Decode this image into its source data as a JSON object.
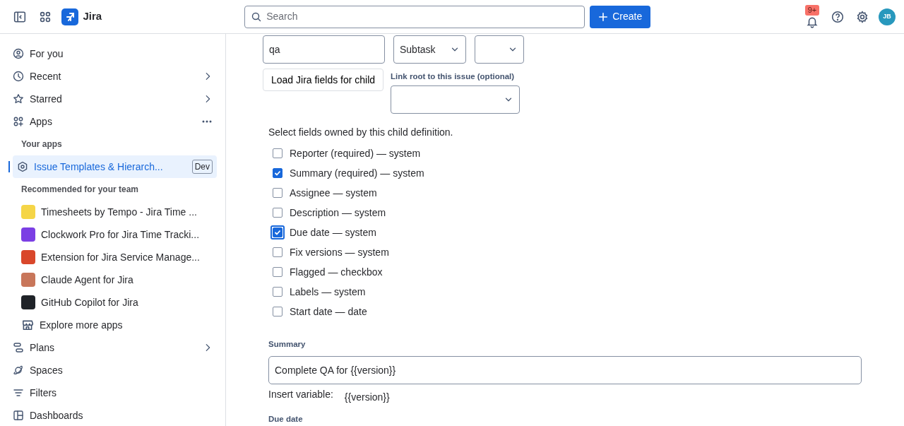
{
  "topbar": {
    "product": "Jira",
    "search": {
      "placeholder": "Search"
    },
    "create_button": "Create",
    "notifications_badge": "9+",
    "avatar": "JB"
  },
  "sidebar": {
    "items": [
      {
        "label": "For you",
        "chevron": false,
        "more": false
      },
      {
        "label": "Recent",
        "chevron": true,
        "more": false
      },
      {
        "label": "Starred",
        "chevron": true,
        "more": false
      },
      {
        "label": "Apps",
        "chevron": false,
        "more": true
      }
    ],
    "your_apps_heading": "Your apps",
    "your_apps": [
      {
        "label": "Issue Templates & Hierarch...",
        "tag": "Dev",
        "selected": true
      }
    ],
    "recommended_heading": "Recommended for your team",
    "recommended": [
      {
        "label": "Timesheets by Tempo - Jira Time ...",
        "color": "#f5d547"
      },
      {
        "label": "Clockwork Pro for Jira Time Tracki...",
        "color": "#7b3fe4"
      },
      {
        "label": "Extension for Jira Service Manage...",
        "color": "#d9472b"
      },
      {
        "label": "Claude Agent for Jira",
        "color": "#c8765a"
      },
      {
        "label": "GitHub Copilot for Jira",
        "color": "#1f2328"
      }
    ],
    "explore": "Explore more apps",
    "bottom_items": [
      {
        "label": "Plans",
        "chevron": true
      },
      {
        "label": "Spaces",
        "chevron": false
      },
      {
        "label": "Filters",
        "chevron": false
      },
      {
        "label": "Dashboards",
        "chevron": false
      }
    ]
  },
  "form": {
    "child_name": {
      "value": "qa"
    },
    "issue_type": {
      "value": "Subtask"
    },
    "load_button": "Load Jira fields for child",
    "link_root": {
      "label": "Link root to this issue (optional)"
    },
    "fields_intro": "Select fields owned by this child definition.",
    "fields": [
      {
        "label": "Reporter (required) — system",
        "checked": false,
        "focused": false
      },
      {
        "label": "Summary (required) — system",
        "checked": true,
        "focused": false
      },
      {
        "label": "Assignee — system",
        "checked": false,
        "focused": false
      },
      {
        "label": "Description — system",
        "checked": false,
        "focused": false
      },
      {
        "label": "Due date — system",
        "checked": true,
        "focused": true
      },
      {
        "label": "Fix versions — system",
        "checked": false,
        "focused": false
      },
      {
        "label": "Flagged — checkbox",
        "checked": false,
        "focused": false
      },
      {
        "label": "Labels — system",
        "checked": false,
        "focused": false
      },
      {
        "label": "Start date — date",
        "checked": false,
        "focused": false
      }
    ],
    "summary": {
      "label": "Summary",
      "value": "Complete QA for {{version}}",
      "insert_label": "Insert variable:",
      "variables": [
        "{{version}}"
      ]
    },
    "next_label": "Due date"
  }
}
